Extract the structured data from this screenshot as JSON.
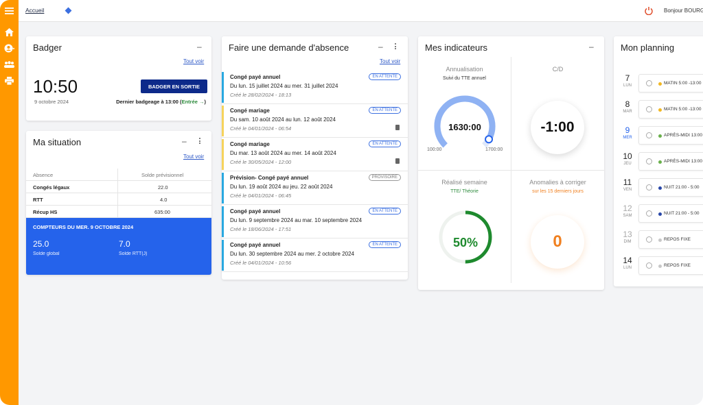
{
  "topbar": {
    "breadcrumb": "Accueil",
    "greeting": "Bonjour BOURG"
  },
  "badger": {
    "title": "Badger",
    "see_all": "Tout voir",
    "time": "10:50",
    "date": "9 octobre 2024",
    "button": "BADGER EN SORTIE",
    "last_prefix": "Dernier badgeage à 13:00 (",
    "last_type": "Entrée",
    "last_suffix": ")"
  },
  "situation": {
    "title": "Ma situation",
    "see_all": "Tout voir",
    "columns": [
      "Absence",
      "Solde prévisionnel"
    ],
    "rows": [
      {
        "label": "Congés légaux",
        "value": "22.0"
      },
      {
        "label": "RTT",
        "value": "4.0"
      },
      {
        "label": "Récup HS",
        "value": "635:00"
      }
    ],
    "counters_title": "COMPTEURS DU MER. 9 OCTOBRE 2024",
    "counters": [
      {
        "value": "25.0",
        "label": "Solde global"
      },
      {
        "value": "7.0",
        "label": "Solde RTT(J)"
      }
    ]
  },
  "absence": {
    "title": "Faire une demande d'absence",
    "see_all": "Tout voir",
    "items": [
      {
        "type": "Congé payé annuel",
        "period": "Du lun. 15 juillet 2024 au mer. 31 juillet 2024",
        "created": "Créé le 28/02/2024 - 18:13",
        "status": "EN ATTENTE",
        "color": "#29a8e0",
        "doc": false
      },
      {
        "type": "Congé mariage",
        "period": "Du sam. 10 août 2024 au lun. 12 août 2024",
        "created": "Créé le 04/01/2024 - 06:54",
        "status": "EN ATTENTE",
        "color": "#f6d35b",
        "doc": true
      },
      {
        "type": "Congé mariage",
        "period": "Du mar. 13 août 2024 au mer. 14 août 2024",
        "created": "Créé le 30/05/2024 - 12:00",
        "status": "EN ATTENTE",
        "color": "#f6d35b",
        "doc": true
      },
      {
        "type": "Prévision- Congé payé annuel",
        "period": "Du lun. 19 août 2024 au jeu. 22 août 2024",
        "created": "Créé le 04/01/2024 - 06:45",
        "status": "PROVISOIRE",
        "color": "#29a8e0",
        "doc": false
      },
      {
        "type": "Congé payé annuel",
        "period": "Du lun. 9 septembre 2024 au mar. 10 septembre 2024",
        "created": "Créé le 18/06/2024 - 17:51",
        "status": "EN ATTENTE",
        "color": "#29a8e0",
        "doc": false
      },
      {
        "type": "Congé payé annuel",
        "period": "Du lun. 30 septembre 2024 au mer. 2 octobre 2024",
        "created": "Créé le 04/01/2024 - 10:56",
        "status": "EN ATTENTE",
        "color": "#29a8e0",
        "doc": false
      }
    ]
  },
  "indicators": {
    "title": "Mes indicateurs",
    "annualisation": {
      "title": "Annualisation",
      "sub": "Suivi du TTE annuel",
      "value": "1630:00",
      "min": "100:00",
      "max": "1700:00",
      "progress": 0.94
    },
    "cd": {
      "title": "C/D",
      "value": "-1:00"
    },
    "week": {
      "title": "Réalisé semaine",
      "sub": "TTE/ Théorie",
      "value": "50%",
      "progress": 0.5
    },
    "anomalies": {
      "title": "Anomalies à corriger",
      "sub": "sur les 15 derniers jours",
      "value": "0"
    }
  },
  "planning": {
    "title": "Mon planning",
    "days": [
      {
        "num": "7",
        "dow": "LUN",
        "slot": "MATIN 5:00 -13:00",
        "dot": "#f2b824",
        "today": false,
        "past": false
      },
      {
        "num": "8",
        "dow": "MAR",
        "slot": "MATIN 5:00 -13:00",
        "dot": "#f2b824",
        "today": false,
        "past": false
      },
      {
        "num": "9",
        "dow": "MER",
        "slot": "APRÈS-MIDI 13:00 -",
        "dot": "#6ab04c",
        "today": true,
        "past": false
      },
      {
        "num": "10",
        "dow": "JEU",
        "slot": "APRÈS-MIDI 13:00 -",
        "dot": "#6ab04c",
        "today": false,
        "past": false
      },
      {
        "num": "11",
        "dow": "VEN",
        "slot": "NUIT 21:00 - 5:00",
        "dot": "#2947a8",
        "today": false,
        "past": false
      },
      {
        "num": "12",
        "dow": "SAM",
        "slot": "NUIT 21:00 - 5:00",
        "dot": "#2947a8",
        "today": false,
        "past": true
      },
      {
        "num": "13",
        "dow": "DIM",
        "slot": "REPOS FIXE",
        "dot": "#c8c8c8",
        "today": false,
        "past": true
      },
      {
        "num": "14",
        "dow": "LUN",
        "slot": "REPOS FIXE",
        "dot": "#c8c8c8",
        "today": false,
        "past": false
      }
    ]
  }
}
